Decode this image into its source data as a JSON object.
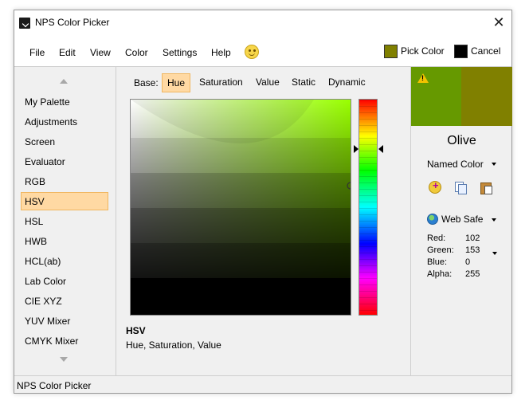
{
  "window": {
    "title": "NPS Color Picker"
  },
  "menu": {
    "items": [
      "File",
      "Edit",
      "View",
      "Color",
      "Settings",
      "Help"
    ],
    "pick_label": "Pick Color",
    "cancel_label": "Cancel",
    "pick_swatch_color": "#808000",
    "cancel_swatch_color": "#000000"
  },
  "sidebar": {
    "items": [
      "My Palette",
      "Adjustments",
      "Screen",
      "Evaluator",
      "RGB",
      "HSV",
      "HSL",
      "HWB",
      "HCL(ab)",
      "Lab Color",
      "CIE XYZ",
      "YUV Mixer",
      "CMYK Mixer"
    ],
    "selected": "HSV"
  },
  "base": {
    "label": "Base:",
    "tabs": [
      "Hue",
      "Saturation",
      "Value",
      "Static",
      "Dynamic"
    ],
    "selected": "Hue"
  },
  "model": {
    "name": "HSV",
    "description": "Hue, Saturation, Value"
  },
  "preview": {
    "old_color": "#669900",
    "new_color": "#808000",
    "warning_icon": "warning-icon"
  },
  "color": {
    "name": "Olive",
    "name_mode": "Named Color",
    "palette_mode": "Web Safe",
    "channels": [
      {
        "label": "Red:",
        "value": "102"
      },
      {
        "label": "Green:",
        "value": "153"
      },
      {
        "label": "Blue:",
        "value": "0"
      },
      {
        "label": "Alpha:",
        "value": "255"
      }
    ]
  },
  "status": {
    "text": "NPS Color Picker"
  }
}
